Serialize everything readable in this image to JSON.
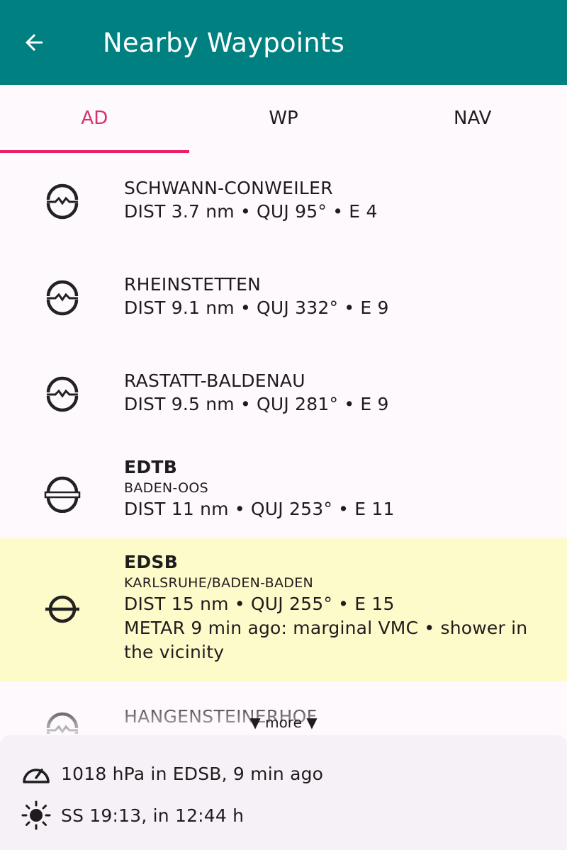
{
  "appbar": {
    "title": "Nearby Waypoints",
    "back_icon": "arrow-left-icon"
  },
  "tabs": [
    {
      "label": "AD",
      "selected": true
    },
    {
      "label": "WP",
      "selected": false
    },
    {
      "label": "NAV",
      "selected": false
    }
  ],
  "colors": {
    "appbar": "#008080",
    "accent": "#e91e63",
    "highlight": "#fdfbc9"
  },
  "waypoints": [
    {
      "name": "SCHWANN-CONWEILER",
      "subtitle": "",
      "info": "DIST 3.7 nm • QUJ 95° • E 4",
      "metar": "",
      "icon": "glider-airfield-icon"
    },
    {
      "name": "RHEINSTETTEN",
      "subtitle": "",
      "info": "DIST 9.1 nm • QUJ 332° • E 9",
      "metar": "",
      "icon": "glider-airfield-icon"
    },
    {
      "name": "RASTATT-BALDENAU",
      "subtitle": "",
      "info": "DIST 9.5 nm • QUJ 281° • E 9",
      "metar": "",
      "icon": "glider-airfield-icon"
    },
    {
      "name": "EDTB",
      "subtitle": "BADEN-OOS",
      "info": "DIST 11 nm • QUJ 253° • E 11",
      "metar": "",
      "icon": "civil-airfield-icon"
    },
    {
      "name": "EDSB",
      "subtitle": "KARLSRUHE/BADEN-BADEN",
      "info": "DIST 15 nm • QUJ 255° • E 15",
      "metar": "METAR 9 min ago: marginal VMC • shower in the vicinity",
      "icon": "airport-icon"
    },
    {
      "name": "HANGENSTEINERHOF",
      "subtitle": "",
      "info": "",
      "metar": "",
      "icon": "glider-airfield-icon"
    }
  ],
  "more_label": "▼ more ▼",
  "bottom": {
    "pressure": "1018 hPa in EDSB, 9 min ago",
    "pressure_icon": "speedometer-icon",
    "sunset": "SS 19:13, in 12:44 h",
    "sunset_icon": "sun-icon"
  }
}
